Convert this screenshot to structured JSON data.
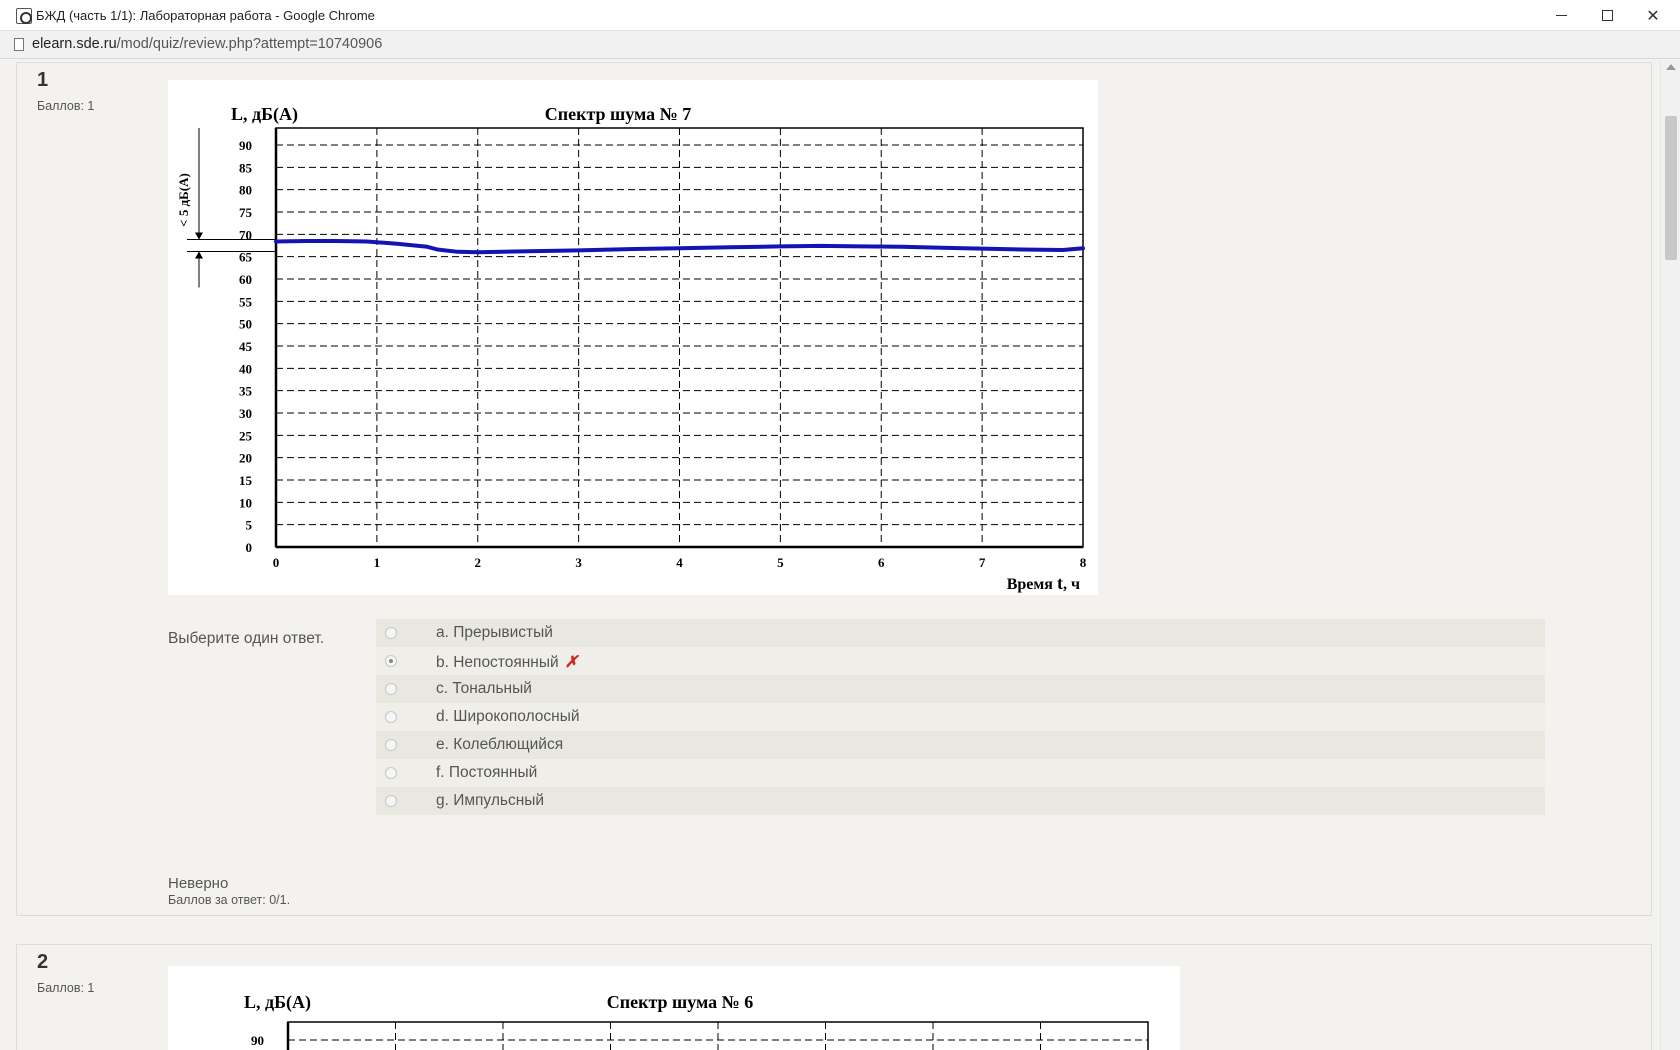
{
  "window": {
    "title": "БЖД (часть 1/1): Лабораторная работа - Google Chrome",
    "url_host": "elearn.sde.ru",
    "url_path": "/mod/quiz/review.php?attempt=10740906"
  },
  "questions": [
    {
      "number": "1",
      "grade": "Баллов: 1",
      "chart_data": {
        "type": "line",
        "title": "Спектр шума  № 7",
        "ylabel": "L, дБ(А)",
        "xlabel_prefix": "Время ",
        "xlabel_var": "t",
        "xlabel_unit": ", ч",
        "annotation": "< 5 дБ(А)",
        "xlim": [
          0,
          8
        ],
        "ylim": [
          0,
          90
        ],
        "x_ticks": [
          "0",
          "1",
          "2",
          "3",
          "4",
          "5",
          "6",
          "7",
          "8"
        ],
        "y_ticks": [
          "0",
          "5",
          "10",
          "15",
          "20",
          "25",
          "30",
          "35",
          "40",
          "45",
          "50",
          "55",
          "60",
          "65",
          "70",
          "75",
          "80",
          "85",
          "90"
        ],
        "grid": true,
        "series": [
          {
            "color": "#1414b4",
            "x": [
              0,
              0.3,
              0.6,
              0.9,
              1.2,
              1.5,
              1.6,
              1.8,
              2.0,
              2.5,
              3.0,
              3.5,
              4.0,
              4.5,
              5.0,
              5.4,
              5.8,
              6.2,
              6.6,
              7.0,
              7.4,
              7.8,
              8.0
            ],
            "y": [
              68.4,
              68.5,
              68.5,
              68.4,
              67.9,
              67.2,
              66.6,
              66.1,
              66.0,
              66.2,
              66.4,
              66.7,
              66.9,
              67.1,
              67.3,
              67.4,
              67.3,
              67.2,
              67.0,
              66.8,
              66.6,
              66.5,
              66.9
            ]
          }
        ]
      },
      "prompt": "Выберите один ответ.",
      "answers": [
        {
          "label": "a. Прерывистый",
          "selected": false,
          "incorrect": false
        },
        {
          "label": "b. Непостоянный",
          "selected": true,
          "incorrect": true
        },
        {
          "label": "c. Тональный",
          "selected": false,
          "incorrect": false
        },
        {
          "label": "d. Широкополосный",
          "selected": false,
          "incorrect": false
        },
        {
          "label": "e. Колеблющийся",
          "selected": false,
          "incorrect": false
        },
        {
          "label": "f. Постоянный",
          "selected": false,
          "incorrect": false
        },
        {
          "label": "g. Импульсный",
          "selected": false,
          "incorrect": false
        }
      ],
      "incorrect_mark": "✗",
      "outcome": "Неверно",
      "outcome_score": "Баллов за ответ: 0/1."
    },
    {
      "number": "2",
      "grade": "Баллов: 1",
      "chart_data": {
        "type": "line",
        "title": "Спектр шума  № 6",
        "ylabel": "L, дБ(А)",
        "ylim": [
          0,
          90
        ],
        "y_ticks": [
          "90"
        ],
        "grid": true
      }
    }
  ]
}
